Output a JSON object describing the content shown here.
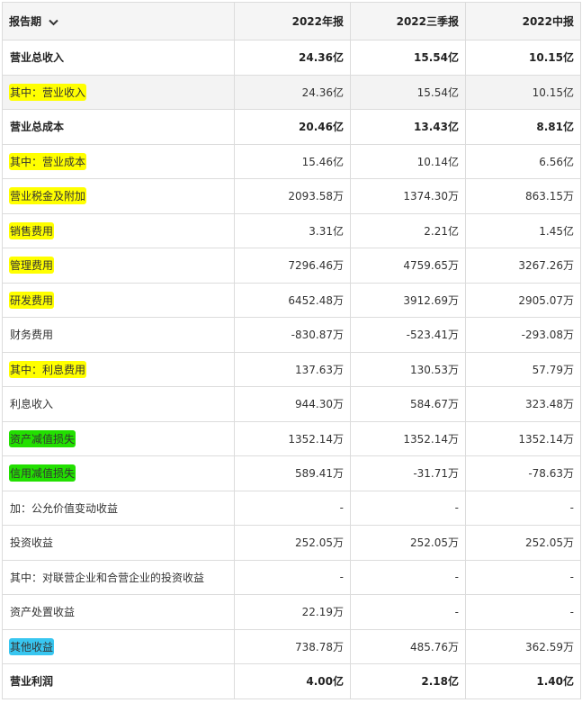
{
  "header": {
    "period_label": "报告期",
    "columns": [
      "2022年报",
      "2022三季报",
      "2022中报"
    ]
  },
  "colors": {
    "highlight_yellow": "#ffff00",
    "highlight_green": "#22e000",
    "highlight_blue": "#38c6f0",
    "header_bg": "#f5f5f5",
    "grid": "#dcdcdc"
  },
  "rows": [
    {
      "label": "营业总收入",
      "values": [
        "24.36亿",
        "15.54亿",
        "10.15亿"
      ],
      "bold": true,
      "highlight": "none"
    },
    {
      "label": "其中：营业收入",
      "values": [
        "24.36亿",
        "15.54亿",
        "10.15亿"
      ],
      "bold": false,
      "highlight": "yellow"
    },
    {
      "label": "营业总成本",
      "values": [
        "20.46亿",
        "13.43亿",
        "8.81亿"
      ],
      "bold": true,
      "highlight": "none"
    },
    {
      "label": "其中：营业成本",
      "values": [
        "15.46亿",
        "10.14亿",
        "6.56亿"
      ],
      "bold": false,
      "highlight": "yellow"
    },
    {
      "label": "营业税金及附加",
      "values": [
        "2093.58万",
        "1374.30万",
        "863.15万"
      ],
      "bold": false,
      "highlight": "yellow"
    },
    {
      "label": "销售费用",
      "values": [
        "3.31亿",
        "2.21亿",
        "1.45亿"
      ],
      "bold": false,
      "highlight": "yellow"
    },
    {
      "label": "管理费用",
      "values": [
        "7296.46万",
        "4759.65万",
        "3267.26万"
      ],
      "bold": false,
      "highlight": "yellow"
    },
    {
      "label": "研发费用",
      "values": [
        "6452.48万",
        "3912.69万",
        "2905.07万"
      ],
      "bold": false,
      "highlight": "yellow"
    },
    {
      "label": "财务费用",
      "values": [
        "-830.87万",
        "-523.41万",
        "-293.08万"
      ],
      "bold": false,
      "highlight": "none"
    },
    {
      "label": "其中：利息费用",
      "values": [
        "137.63万",
        "130.53万",
        "57.79万"
      ],
      "bold": false,
      "highlight": "yellow"
    },
    {
      "label": "利息收入",
      "values": [
        "944.30万",
        "584.67万",
        "323.48万"
      ],
      "bold": false,
      "highlight": "none"
    },
    {
      "label": "资产减值损失",
      "values": [
        "1352.14万",
        "1352.14万",
        "1352.14万"
      ],
      "bold": false,
      "highlight": "green"
    },
    {
      "label": "信用减值损失",
      "values": [
        "589.41万",
        "-31.71万",
        "-78.63万"
      ],
      "bold": false,
      "highlight": "green"
    },
    {
      "label": "加：公允价值变动收益",
      "values": [
        "-",
        "-",
        "-"
      ],
      "bold": false,
      "highlight": "none"
    },
    {
      "label": "投资收益",
      "values": [
        "252.05万",
        "252.05万",
        "252.05万"
      ],
      "bold": false,
      "highlight": "none"
    },
    {
      "label": "其中：对联营企业和合营企业的投资收益",
      "values": [
        "-",
        "-",
        "-"
      ],
      "bold": false,
      "highlight": "none"
    },
    {
      "label": "资产处置收益",
      "values": [
        "22.19万",
        "-",
        "-"
      ],
      "bold": false,
      "highlight": "none"
    },
    {
      "label": "其他收益",
      "values": [
        "738.78万",
        "485.76万",
        "362.59万"
      ],
      "bold": false,
      "highlight": "blue"
    },
    {
      "label": "营业利润",
      "values": [
        "4.00亿",
        "2.18亿",
        "1.40亿"
      ],
      "bold": true,
      "highlight": "none"
    }
  ]
}
